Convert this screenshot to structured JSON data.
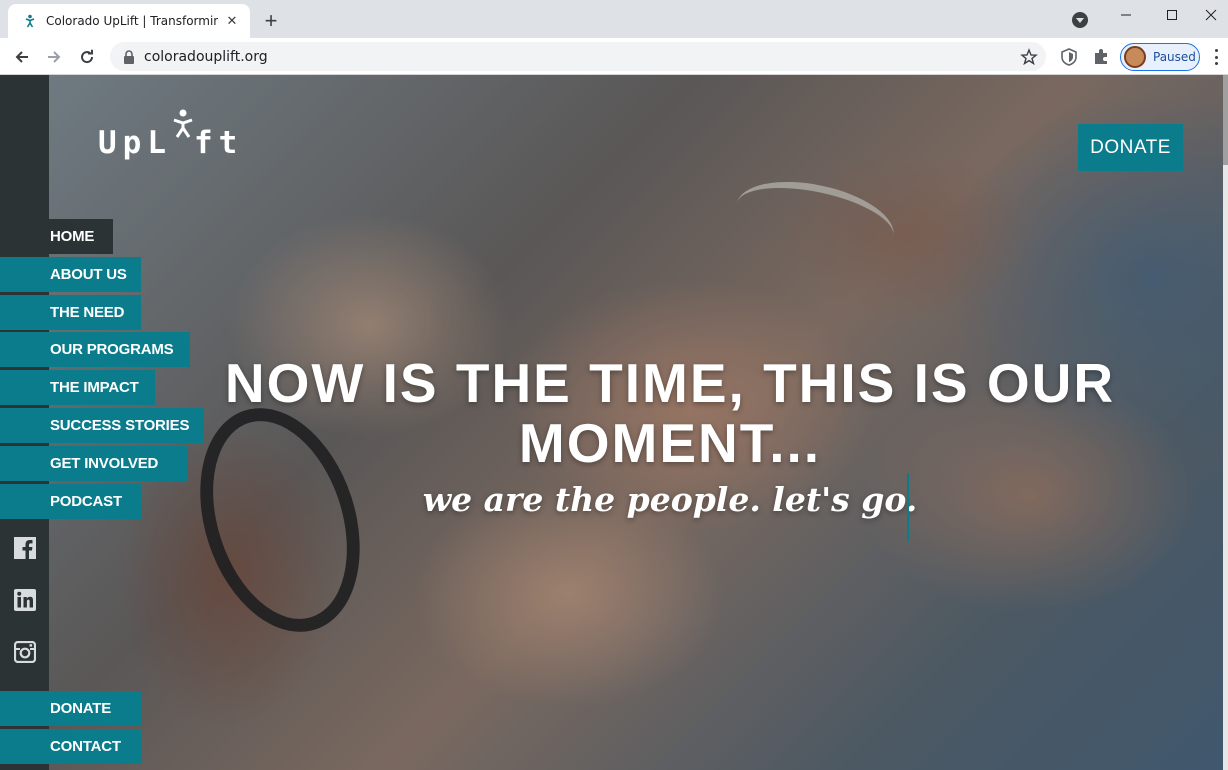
{
  "browser": {
    "tab_title": "Colorado UpLift | Transforming Li",
    "url": "coloradouplift.org",
    "profile_status": "Paused"
  },
  "site": {
    "logo_text_a": "UpL",
    "logo_text_b": "ft",
    "donate_top_label": "DONATE",
    "nav": [
      {
        "label": "HOME",
        "active": true
      },
      {
        "label": "ABOUT US"
      },
      {
        "label": "THE NEED"
      },
      {
        "label": "OUR PROGRAMS"
      },
      {
        "label": "THE IMPACT"
      },
      {
        "label": "SUCCESS STORIES"
      },
      {
        "label": "GET INVOLVED"
      },
      {
        "label": "PODCAST"
      }
    ],
    "social_icons": [
      "facebook-icon",
      "linkedin-icon",
      "instagram-icon"
    ],
    "bottom_nav": [
      {
        "label": "DONATE"
      },
      {
        "label": "CONTACT"
      }
    ],
    "hero": {
      "headline": "NOW IS THE TIME, THIS IS OUR MOMENT...",
      "tagline": "we are the people. let's go."
    },
    "colors": {
      "accent": "#0a7c8c",
      "sidebar": "#2b3335"
    }
  }
}
